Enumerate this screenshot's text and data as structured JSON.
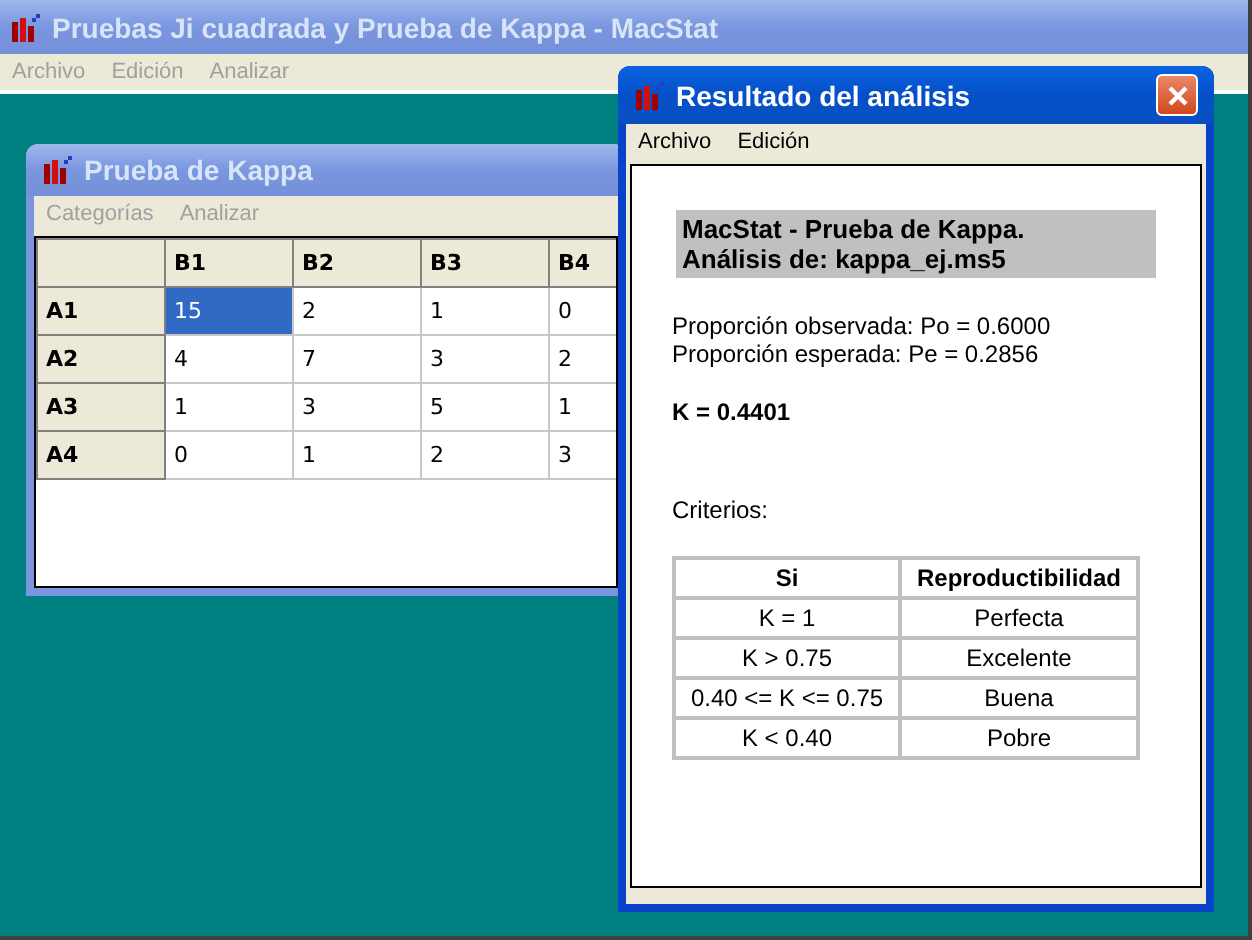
{
  "main_window": {
    "title": "Pruebas Ji cuadrada y Prueba de Kappa - MacStat",
    "active": false,
    "menu": [
      {
        "label": "Archivo",
        "disabled": true
      },
      {
        "label": "Edición",
        "disabled": true
      },
      {
        "label": "Analizar",
        "disabled": true
      }
    ]
  },
  "kappa_window": {
    "title": "Prueba de Kappa",
    "active": false,
    "menu": [
      {
        "label": "Categorías",
        "disabled": true
      },
      {
        "label": "Analizar",
        "disabled": true
      }
    ],
    "grid": {
      "columns": [
        "B1",
        "B2",
        "B3",
        "B4"
      ],
      "rows": [
        {
          "label": "A1",
          "cells": [
            {
              "value": "15",
              "selected": true
            },
            {
              "value": "2",
              "selected": false
            },
            {
              "value": "1",
              "selected": false
            },
            {
              "value": "0",
              "selected": false
            }
          ]
        },
        {
          "label": "A2",
          "cells": [
            {
              "value": "4",
              "selected": false
            },
            {
              "value": "7",
              "selected": false
            },
            {
              "value": "3",
              "selected": false
            },
            {
              "value": "2",
              "selected": false
            }
          ]
        },
        {
          "label": "A3",
          "cells": [
            {
              "value": "1",
              "selected": false
            },
            {
              "value": "3",
              "selected": false
            },
            {
              "value": "5",
              "selected": false
            },
            {
              "value": "1",
              "selected": false
            }
          ]
        },
        {
          "label": "A4",
          "cells": [
            {
              "value": "0",
              "selected": false
            },
            {
              "value": "1",
              "selected": false
            },
            {
              "value": "2",
              "selected": false
            },
            {
              "value": "3",
              "selected": false
            }
          ]
        }
      ]
    }
  },
  "result_window": {
    "title": "Resultado del análisis",
    "active": true,
    "menu": [
      {
        "label": "Archivo",
        "disabled": false
      },
      {
        "label": "Edición",
        "disabled": false
      }
    ],
    "report": {
      "heading": [
        "MacStat - Prueba de Kappa.",
        "Análisis de: kappa_ej.ms5"
      ],
      "proportions": [
        "Proporción observada: Po = 0.6000",
        "Proporción esperada: Pe = 0.2856"
      ],
      "kappa": "K = 0.4401",
      "criteria_label": "Criterios:",
      "criteria_table": {
        "columns": [
          "Si",
          "Reproductibilidad"
        ],
        "rows": [
          [
            "K = 1",
            "Perfecta"
          ],
          [
            "K > 0.75",
            "Excelente"
          ],
          [
            "0.40 <= K <= 0.75",
            "Buena"
          ],
          [
            "K < 0.40",
            "Pobre"
          ]
        ]
      }
    }
  }
}
